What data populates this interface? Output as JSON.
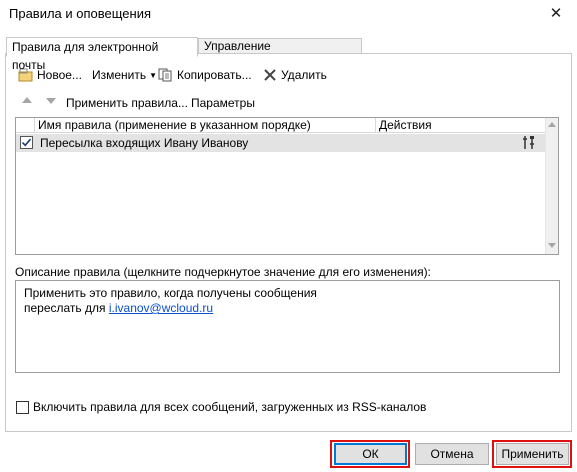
{
  "window": {
    "title": "Правила и оповещения"
  },
  "tabs": [
    {
      "label": "Правила для электронной почты",
      "active": true
    },
    {
      "label": "Управление оповещениями",
      "active": false
    }
  ],
  "toolbar": {
    "new_label": "Новое...",
    "edit_label": "Изменить",
    "copy_label": "Копировать...",
    "delete_label": "Удалить",
    "apply_rules_label": "Применить правила...",
    "options_label": "Параметры"
  },
  "rules_list": {
    "columns": [
      "Имя правила (применение в указанном порядке)",
      "Действия"
    ],
    "rows": [
      {
        "name": "Пересылка входящих Ивану Иванову",
        "checked": true
      }
    ]
  },
  "description": {
    "label": "Описание правила (щелкните подчеркнутое значение для его изменения):",
    "line1": "Применить это правило, когда получены сообщения",
    "line2_prefix": "переслать для",
    "link": "i.ivanov@wcloud.ru"
  },
  "rss_option": {
    "label": "Включить правила для всех сообщений, загруженных из RSS-каналов",
    "checked": false
  },
  "buttons": {
    "ok": "ОК",
    "cancel": "Отмена",
    "apply": "Применить"
  },
  "colors": {
    "highlight": "#e01010",
    "link": "#0b4fd1",
    "selected_row": "#e3e3e3"
  },
  "icons": [
    "new-rule-icon",
    "edit-dropdown-icon",
    "copy-icon",
    "delete-icon",
    "move-up-icon",
    "move-down-icon",
    "rule-action-icon",
    "close-icon"
  ]
}
